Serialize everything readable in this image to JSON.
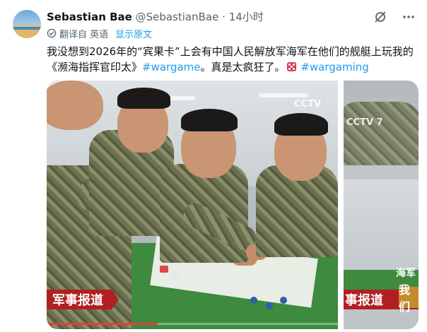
{
  "tweet": {
    "author_name": "Sebastian Bae",
    "handle": "@SebastianBae",
    "separator": "·",
    "time": "14小时",
    "translation": {
      "label": "翻译自 英语",
      "show_original": "显示原文"
    },
    "text_part1": "我没想到2026年的“宾果卡”上会有中国人民解放军海军在他们的舰艇上玩我的《濒海指挥官印太》",
    "hashtag1": "#wargame",
    "text_part2": "。真是太疯狂了。",
    "hashtag2": "#wargaming",
    "icons": [
      "grok-icon",
      "more-icon",
      "translate-icon",
      "dice-emoji"
    ]
  },
  "media": {
    "image1": {
      "broadcast_logo": "CCTV",
      "banner_text": "军事报道",
      "progress_fraction": 0.38
    },
    "image2": {
      "broadcast_logo": "CCTV 7",
      "banner_text": "事报道",
      "side_label": "海军",
      "overlay_text": "我们"
    }
  },
  "colors": {
    "link": "#1d9bf0",
    "secondary_text": "#536471",
    "banner_red": "#b11f21",
    "table_green": "#3e8a3f"
  }
}
